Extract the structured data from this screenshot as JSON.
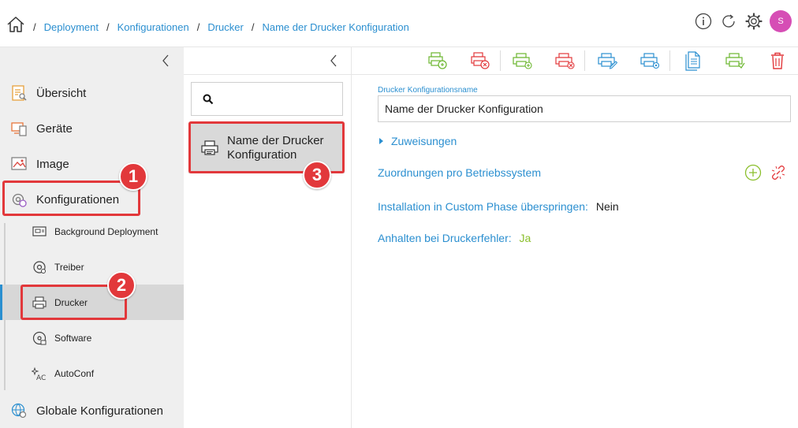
{
  "breadcrumb": {
    "items": [
      "Deployment",
      "Konfigurationen",
      "Drucker",
      "Name der Drucker Konfiguration"
    ],
    "separator": "/"
  },
  "header": {
    "avatar_initial": "S",
    "icons": [
      "info-icon",
      "refresh-icon",
      "gear-icon"
    ]
  },
  "sidebar": {
    "items": [
      {
        "label": "Übersicht",
        "icon": "overview-icon"
      },
      {
        "label": "Geräte",
        "icon": "devices-icon"
      },
      {
        "label": "Image",
        "icon": "image-icon"
      },
      {
        "label": "Konfigurationen",
        "icon": "configurations-icon"
      }
    ],
    "subitems": [
      {
        "label": "Background Deployment",
        "icon": "background-deployment-icon"
      },
      {
        "label": "Treiber",
        "icon": "driver-icon"
      },
      {
        "label": "Drucker",
        "icon": "printer-icon",
        "active": true
      },
      {
        "label": "Software",
        "icon": "software-icon"
      },
      {
        "label": "AutoConf",
        "icon": "autoconf-icon"
      }
    ],
    "bottom_item": {
      "label": "Globale Konfigurationen",
      "icon": "global-configurations-icon"
    }
  },
  "list": {
    "search_value": "",
    "items": [
      {
        "label": "Name der Drucker Konfiguration"
      }
    ]
  },
  "detail": {
    "name_label": "Drucker Konfigurationsname",
    "name_value": "Name der Drucker Konfiguration",
    "zuweisungen": "Zuweisungen",
    "zuordnungen": "Zuordnungen pro Betriebssystem",
    "custom_phase_label": "Installation in Custom Phase überspringen:",
    "custom_phase_value": "Nein",
    "printer_error_label": "Anhalten bei Druckerfehler:",
    "printer_error_value": "Ja"
  },
  "annotations": [
    "1",
    "2",
    "3"
  ],
  "colors": {
    "accent": "#2b8fd0",
    "callout": "#e2383b",
    "green": "#8bbf2c",
    "delete": "#e2383b",
    "avatar": "#d64eb5"
  }
}
